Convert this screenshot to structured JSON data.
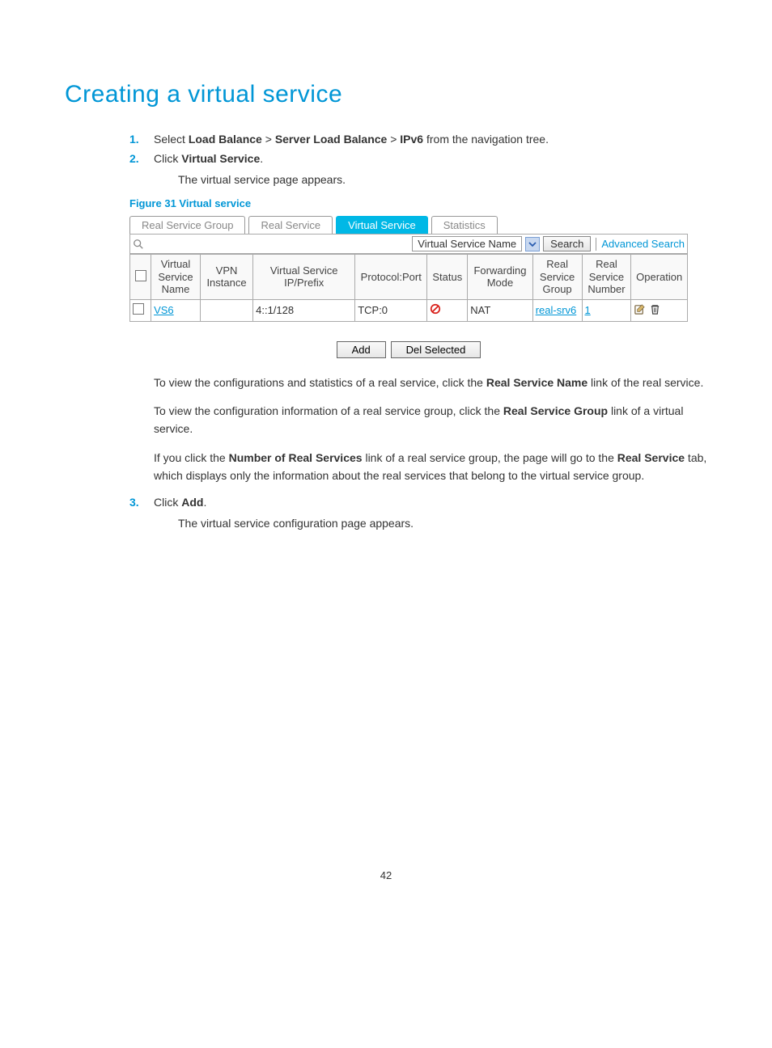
{
  "heading": "Creating a virtual service",
  "step1": {
    "num": "1.",
    "pre": "Select ",
    "b1": "Load Balance",
    "sep1": " > ",
    "b2": "Server Load Balance",
    "sep2": " > ",
    "b3": "IPv6",
    "post": " from the navigation tree."
  },
  "step2": {
    "num": "2.",
    "pre": "Click ",
    "b1": "Virtual Service",
    "post": ".",
    "sub": "The virtual service page appears."
  },
  "figcap": "Figure 31 Virtual service",
  "tabs": {
    "t0": "Real Service Group",
    "t1": "Real Service",
    "t2": "Virtual Service",
    "t3": "Statistics"
  },
  "searchbar": {
    "dropdown": "Virtual Service Name",
    "searchbtn": "Search",
    "adv": "Advanced Search"
  },
  "cols": {
    "c0": "Virtual Service Name",
    "c1": "VPN Instance",
    "c2": "Virtual Service IP/Prefix",
    "c3": "Protocol:Port",
    "c4": "Status",
    "c5": "Forwarding Mode",
    "c6": "Real Service Group",
    "c7": "Real Service Number",
    "c8": "Operation"
  },
  "row": {
    "name": "VS6",
    "vpn": "",
    "ip": "4::1/128",
    "proto": "TCP:0",
    "mode": "NAT",
    "group": "real-srv6",
    "num": "1"
  },
  "buttons": {
    "add": "Add",
    "del": "Del Selected"
  },
  "p1": {
    "a": "To view the configurations and statistics of a real service, click the ",
    "b": "Real Service Name",
    "c": " link of the real service."
  },
  "p2": {
    "a": "To view the configuration information of a real service group, click the ",
    "b": "Real Service Group",
    "c": " link of a virtual service."
  },
  "p3": {
    "a": "If you click the ",
    "b": "Number of Real Services",
    "c": " link of a real service group, the page will go to the ",
    "d": "Real Service",
    "e": " tab, which displays only the information about the real services that belong to the virtual service group."
  },
  "step3": {
    "num": "3.",
    "pre": "Click ",
    "b1": "Add",
    "post": ".",
    "sub": "The virtual service configuration page appears."
  },
  "pagenum": "42"
}
